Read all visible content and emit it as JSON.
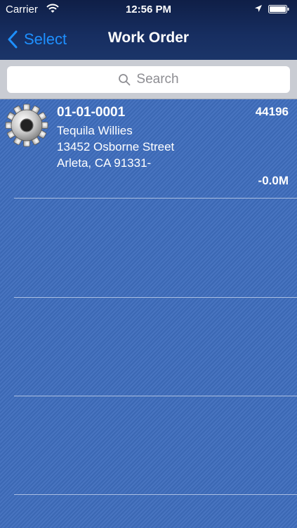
{
  "status_bar": {
    "carrier": "Carrier",
    "time": "12:56 PM"
  },
  "nav": {
    "back_label": "Select",
    "title": "Work Order"
  },
  "search": {
    "placeholder": "Search"
  },
  "work_orders": [
    {
      "number": "01-01-0001",
      "id": "44196",
      "name": "Tequila Willies",
      "street": "13452 Osborne Street",
      "city_state_zip": "Arleta, CA 91331-",
      "amount": "-0.0M",
      "icon": "gear-icon"
    }
  ],
  "colors": {
    "nav_background": "#172e61",
    "accent": "#1e90ff",
    "list_background": "#3e6dbd"
  }
}
